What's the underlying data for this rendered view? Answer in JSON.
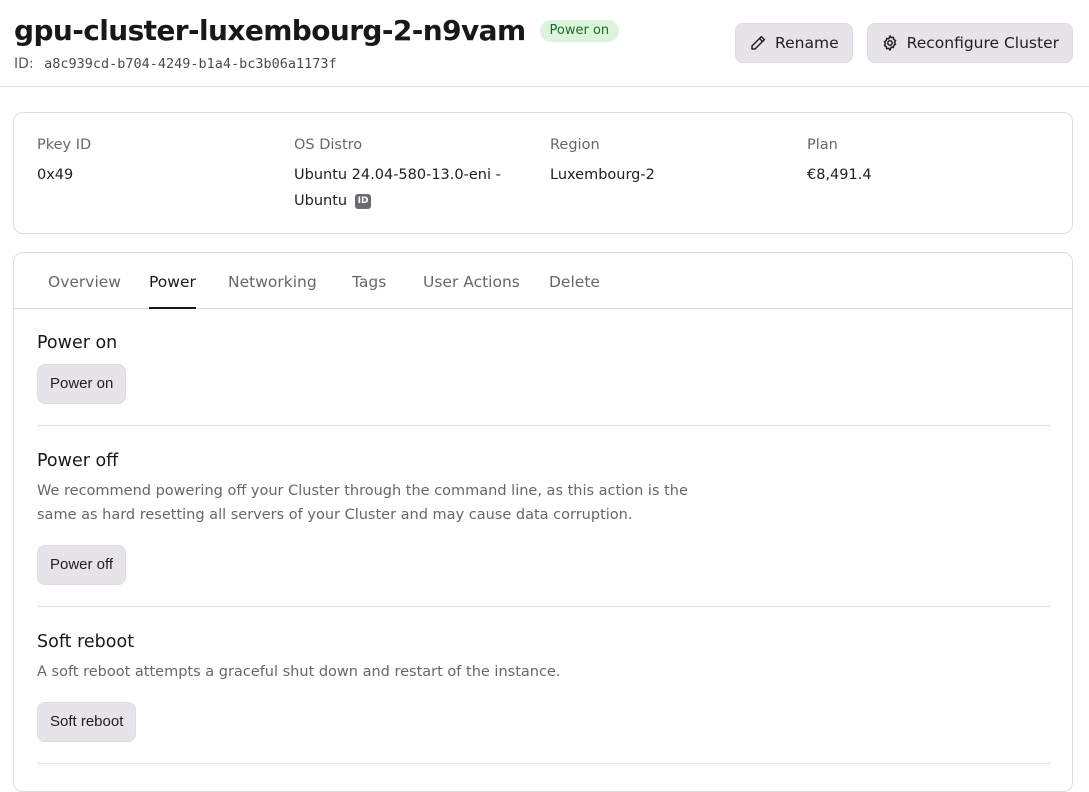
{
  "header": {
    "title": "gpu-cluster-luxembourg-2-n9vam",
    "status_badge": "Power on",
    "id_label": "ID:",
    "id_value": "a8c939cd-b704-4249-b1a4-bc3b06a1173f",
    "rename_label": "Rename",
    "reconfigure_label": "Reconfigure Cluster"
  },
  "info": {
    "pkey_label": "Pkey ID",
    "pkey_value": "0x49",
    "os_label": "OS Distro",
    "os_value_line1": "Ubuntu 24.04-580-13.0-eni -",
    "os_value_line2": "Ubuntu",
    "os_chip": "ID",
    "region_label": "Region",
    "region_value": "Luxembourg-2",
    "plan_label": "Plan",
    "plan_value": "€8,491.4"
  },
  "tabs": [
    {
      "label": "Overview"
    },
    {
      "label": "Power"
    },
    {
      "label": "Networking"
    },
    {
      "label": "Tags"
    },
    {
      "label": "User Actions"
    },
    {
      "label": "Delete"
    }
  ],
  "active_tab": "Power",
  "power": {
    "on_title": "Power on",
    "on_button": "Power on",
    "off_title": "Power off",
    "off_desc": "We recommend powering off your Cluster through the command line, as this action is the same as hard resetting all servers of your Cluster and may cause data corruption.",
    "off_button": "Power off",
    "reboot_title": "Soft reboot",
    "reboot_desc": "A soft reboot attempts a graceful shut down and restart of the instance.",
    "reboot_button": "Soft reboot"
  },
  "colors": {
    "badge_bg": "#dcf3dc",
    "badge_text": "#1d6a2c",
    "button_bg": "#e6e4e9"
  }
}
